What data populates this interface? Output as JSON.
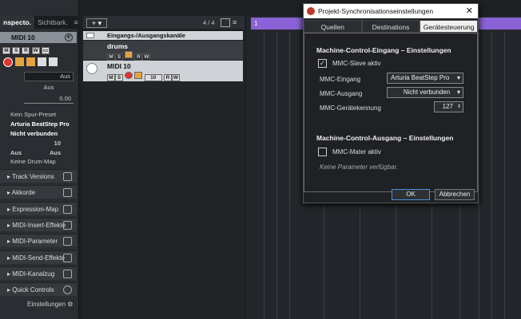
{
  "inspector": {
    "tabs": [
      "nspecto.",
      "Sichtbark."
    ],
    "track_name": "MIDI 10",
    "pan_top": "Aus",
    "pan_mid": "Aus",
    "volume": "0.00",
    "preset": "Kein Spur-Preset",
    "input": "Arturia BeatStep Pro",
    "output": "Nicht verbunden",
    "channel": "10",
    "in_send": "Aus",
    "out_send": "Aus",
    "drum_map": "Keine Drum-Map",
    "sections": [
      "Track Versions",
      "Akkorde",
      "Expression-Map",
      "MIDI-Insert-Effekte",
      "MIDI-Parameter",
      "MIDI-Send-Effekte",
      "MIDI-Kanalzug",
      "Quick Controls"
    ],
    "settings": "Einstellungen"
  },
  "project": {
    "track_count": "4 / 4",
    "folder": "Eingangs-/Ausgangskanäle",
    "track1": "drums",
    "track2": "MIDI 10",
    "track2_ch": "10"
  },
  "ruler": {
    "marker": "1"
  },
  "dialog": {
    "title": "Projekt-Synchronisationseinstellungen",
    "tabs": [
      "Quellen",
      "Destinations",
      "Gerätesteuerung"
    ],
    "in_heading": "Machine-Control-Eingang – Einstellungen",
    "slave_label": "MMC-Slave aktiv",
    "slave_checked": true,
    "in_label": "MMC-Eingang",
    "in_value": "Arturia BeatStep Pro",
    "out_label": "MMC-Ausgang",
    "out_value": "Nicht verbunden",
    "id_label": "MMC-Gerätekennung",
    "id_value": "127",
    "out_heading": "Machine-Control-Ausgang – Einstellungen",
    "master_label": "MMC-Mater aktiv",
    "no_params": "Keine Parameter verfügbar.",
    "ok": "OK",
    "cancel": "Abbrechen"
  },
  "colors": {
    "ruler": "#8b63d6",
    "record": "#e0342c"
  }
}
